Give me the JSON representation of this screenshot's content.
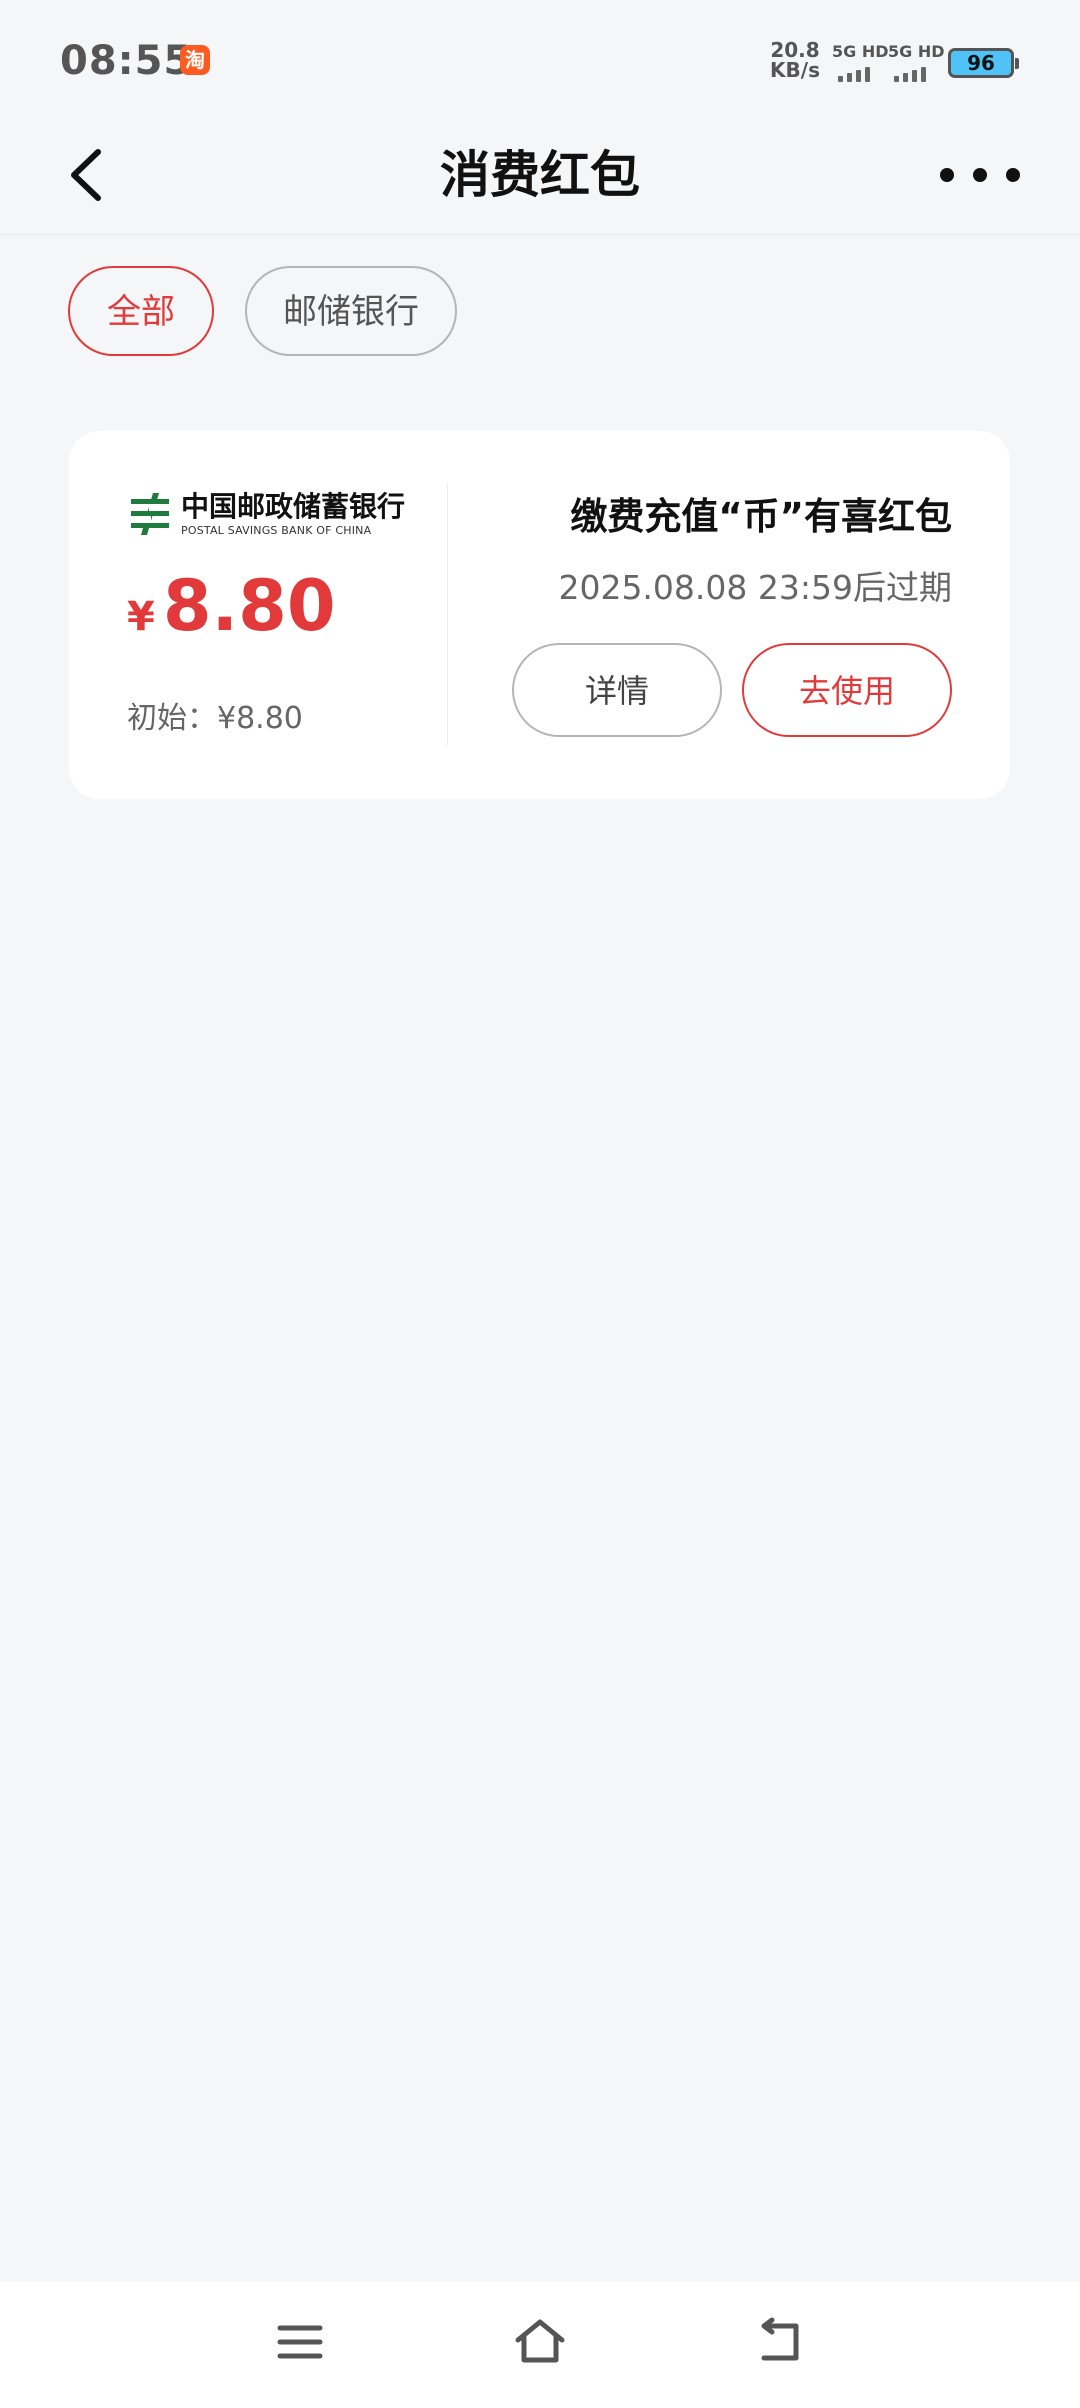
{
  "status_bar": {
    "time": "08:55",
    "app_icon_glyph": "淘",
    "net_speed_value": "20.8",
    "net_speed_unit": "KB/s",
    "signal1_label": "5G HD",
    "signal2_label": "5G HD",
    "battery": "96"
  },
  "header": {
    "title": "消费红包"
  },
  "filters": {
    "all": "全部",
    "psbc": "邮储银行"
  },
  "card": {
    "bank_name_cn": "中国邮政储蓄银行",
    "bank_name_en": "POSTAL SAVINGS BANK OF CHINA",
    "currency": "¥",
    "amount": "8.80",
    "initial": "初始：¥8.80",
    "promo_title": "缴费充值“币”有喜红包",
    "expire": "2025.08.08 23:59后过期",
    "detail_button": "详情",
    "use_button": "去使用"
  },
  "colors": {
    "accent": "#e23a3a",
    "background": "#f5f6f8",
    "psbc_green": "#1f7a3d"
  }
}
